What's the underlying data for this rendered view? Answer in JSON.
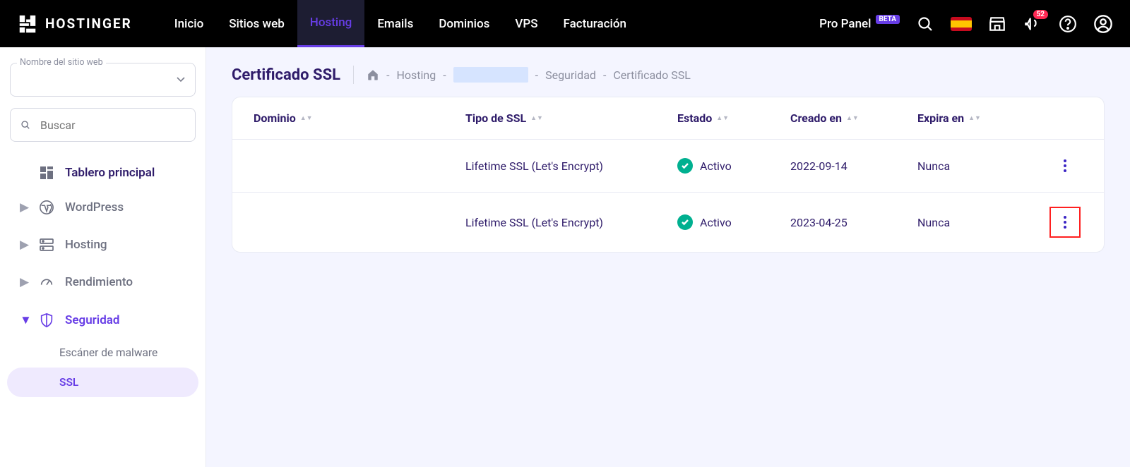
{
  "brand": "HOSTINGER",
  "nav": {
    "items": [
      "Inicio",
      "Sitios web",
      "Hosting",
      "Emails",
      "Dominios",
      "VPS",
      "Facturación"
    ],
    "active_index": 2,
    "pro_panel": "Pro Panel",
    "beta": "BETA",
    "notif_count": "52"
  },
  "sidebar": {
    "site_select_label": "Nombre del sitio web",
    "search_placeholder": "Buscar",
    "dashboard": "Tablero principal",
    "groups": [
      "WordPress",
      "Hosting",
      "Rendimiento",
      "Seguridad"
    ],
    "active_group_index": 3,
    "subitems": [
      "Escáner de malware",
      "SSL"
    ],
    "active_sub_index": 1
  },
  "page": {
    "title": "Certificado SSL",
    "breadcrumb": {
      "hosting": "Hosting",
      "security": "Seguridad",
      "ssl": "Certificado SSL"
    }
  },
  "table": {
    "headers": {
      "domain": "Dominio",
      "type": "Tipo de SSL",
      "status": "Estado",
      "created": "Creado en",
      "expires": "Expira en"
    },
    "rows": [
      {
        "domain": "",
        "type": "Lifetime SSL (Let's Encrypt)",
        "status": "Activo",
        "created": "2022-09-14",
        "expires": "Nunca"
      },
      {
        "domain": "",
        "type": "Lifetime SSL (Let's Encrypt)",
        "status": "Activo",
        "created": "2023-04-25",
        "expires": "Nunca"
      }
    ],
    "highlight_row_index": 1
  }
}
